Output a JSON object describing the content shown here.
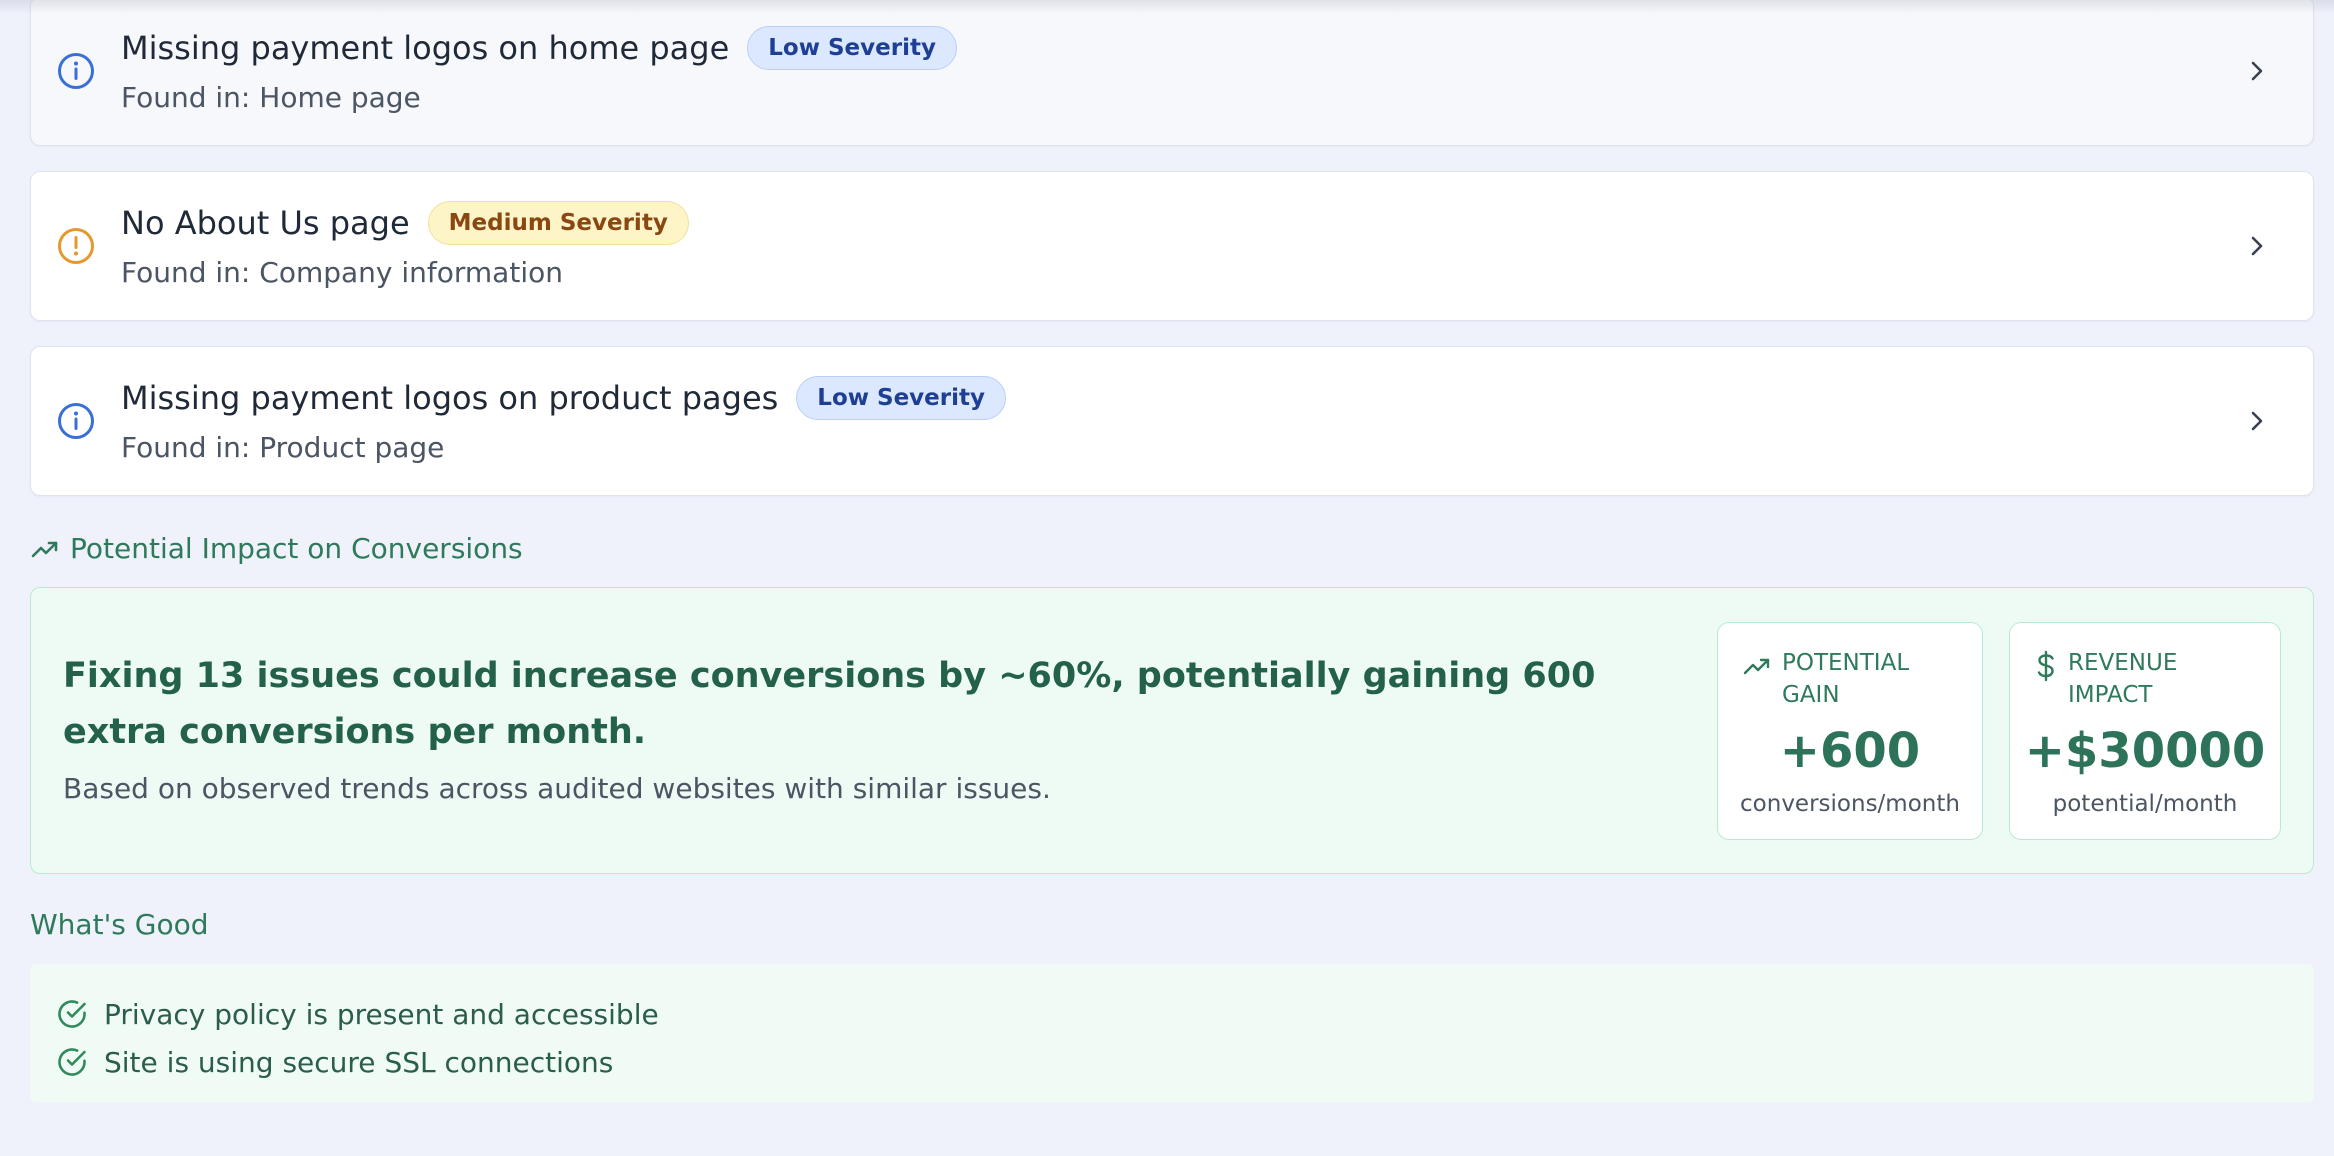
{
  "issues": [
    {
      "title": "Missing payment logos on home page",
      "severity": "Low Severity",
      "severity_level": "low",
      "icon": "info-icon",
      "found_in": "Found in: Home page"
    },
    {
      "title": "No About Us page",
      "severity": "Medium Severity",
      "severity_level": "medium",
      "icon": "warning-icon",
      "found_in": "Found in: Company information"
    },
    {
      "title": "Missing payment logos on product pages",
      "severity": "Low Severity",
      "severity_level": "low",
      "icon": "info-icon",
      "found_in": "Found in: Product page"
    }
  ],
  "impact": {
    "heading": "Potential Impact on Conversions",
    "headline": "Fixing 13 issues could increase conversions by ~60%, potentially gaining 600 extra conversions per month.",
    "note": "Based on observed trends across audited websites with similar issues.",
    "stats": {
      "gain": {
        "label": "POTENTIAL GAIN",
        "value": "+600",
        "unit": "conversions/month",
        "icon": "trending-up-icon"
      },
      "revenue": {
        "label": "REVENUE IMPACT",
        "value": "+$30000",
        "unit": "potential/month",
        "icon": "dollar-icon"
      }
    }
  },
  "good": {
    "heading": "What's Good",
    "items": [
      "Privacy policy is present and accessible",
      "Site is using secure SSL connections"
    ]
  },
  "colors": {
    "info_blue": "#3b6fd8",
    "warning_orange": "#e5992d",
    "success_green": "#2f7a5a",
    "background": "#eff1fb"
  }
}
